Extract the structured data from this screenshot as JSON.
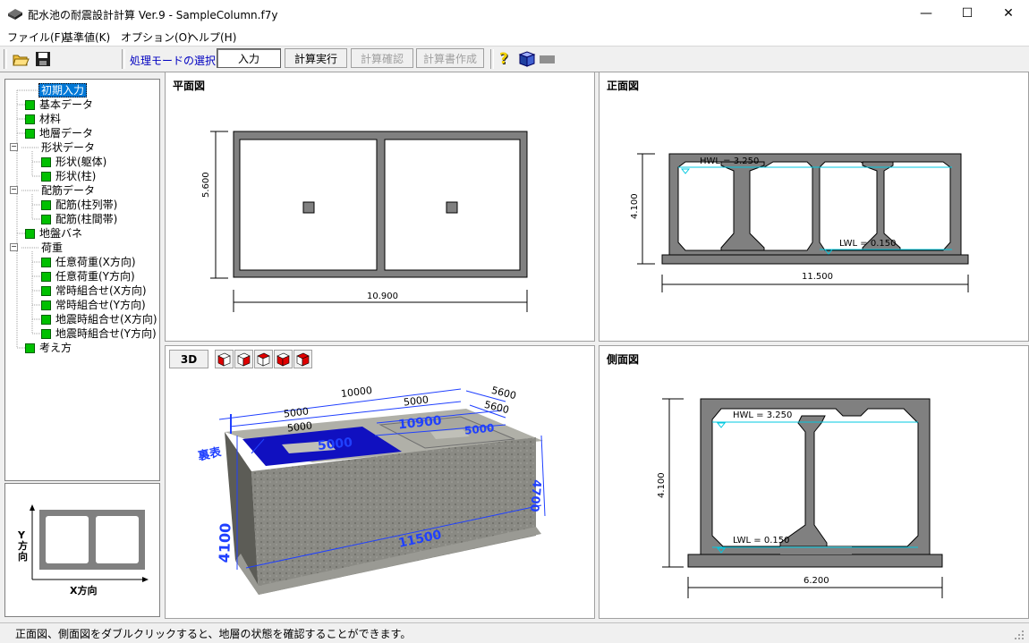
{
  "window": {
    "title": "配水池の耐震設計計算 Ver.9 - SampleColumn.f7y"
  },
  "menu": [
    "ファイル(F)",
    "基準値(K)",
    "オプション(O)",
    "ヘルプ(H)"
  ],
  "toolbar": {
    "mode_label": "処理モードの選択",
    "buttons": {
      "input": "入力",
      "run": "計算実行",
      "confirm": "計算確認",
      "report": "計算書作成"
    }
  },
  "tree": {
    "root": "初期入力",
    "items": [
      "基本データ",
      "材料",
      "地層データ",
      "形状データ",
      "形状(躯体)",
      "形状(柱)",
      "配筋データ",
      "配筋(柱列帯)",
      "配筋(柱間帯)",
      "地盤バネ",
      "荷重",
      "任意荷重(X方向)",
      "任意荷重(Y方向)",
      "常時組合せ(X方向)",
      "常時組合せ(Y方向)",
      "地震時組合せ(X方向)",
      "地震時組合せ(Y方向)",
      "考え方"
    ]
  },
  "thumb": {
    "y_label": "Y方向",
    "x_label": "X方向"
  },
  "plan": {
    "title": "平面図",
    "width_dim": "10.900",
    "height_dim": "5.600"
  },
  "front": {
    "title": "正面図",
    "hwl": "HWL = 3.250",
    "lwl": "LWL = 0.150",
    "height_dim": "4.100",
    "width_dim": "11.500"
  },
  "view3d": {
    "button": "3D",
    "dims": {
      "top_total": "10000",
      "top_a": "5000",
      "top_b": "5000",
      "top_c": "5000",
      "top_d": "5600",
      "side_e": "5600",
      "inner_a": "10900",
      "inner_b": "5000",
      "inner_c": "5000",
      "height": "4700",
      "length": "11500",
      "height_left": "4100",
      "side_label": "裏表"
    }
  },
  "side": {
    "title": "側面図",
    "hwl": "HWL = 3.250",
    "lwl": "LWL = 0.150",
    "height_dim": "4.100",
    "width_dim": "6.200"
  },
  "status": "正面図、側面図をダブルクリックすると、地層の状態を確認することができます。",
  "colors": {
    "concrete": "#808080",
    "water": "#00c8e0",
    "accent": "#0000c0",
    "dim3d": "#2040ff",
    "tree_square": "#00c000"
  }
}
